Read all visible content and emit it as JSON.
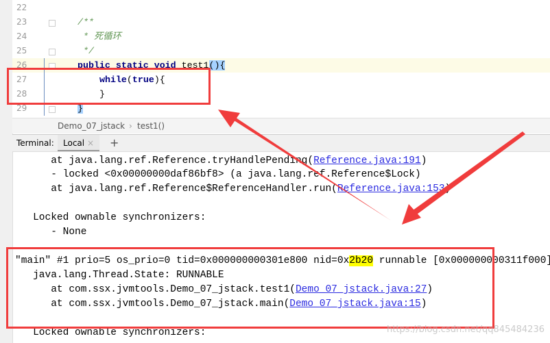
{
  "editor": {
    "lines": [
      {
        "num": "22",
        "text": ""
      },
      {
        "num": "23",
        "text": "/**"
      },
      {
        "num": "24",
        "text": " * 死循环"
      },
      {
        "num": "25",
        "text": " */"
      },
      {
        "num": "26",
        "kw": "public static void",
        "text": " test1",
        "sel": "(){"
      },
      {
        "num": "27",
        "kw": "while",
        "text": "(",
        "kw2": "true",
        "text2": "){"
      },
      {
        "num": "28",
        "text": "}"
      },
      {
        "num": "29",
        "text": "}"
      }
    ]
  },
  "breadcrumb": {
    "file": "Demo_07_jstack",
    "sep": "›",
    "method": "test1()"
  },
  "terminal": {
    "label": "Terminal:",
    "tab": "Local",
    "close": "×",
    "add": "+",
    "lines": {
      "l1a": "      at java.lang.ref.Reference.tryHandlePending(",
      "l1b": "Reference.java:191",
      "l1c": ")",
      "l2": "      - locked <0x00000000daf86bf8> (a java.lang.ref.Reference$Lock)",
      "l3a": "      at java.lang.ref.Reference$ReferenceHandler.run(",
      "l3b": "Reference.java:153",
      "l3c": ")",
      "l4": "   Locked ownable synchronizers:",
      "l5": "      - None",
      "l6a": "\"main\" #1 prio=5 os_prio=0 tid=0x000000000301e800 nid=0x",
      "l6b": "2b20",
      "l6c": " runnable [0x000000000311f000]",
      "l7": "   java.lang.Thread.State: RUNNABLE",
      "l8a": "      at com.ssx.jvmtools.Demo_07_jstack.test1(",
      "l8b": "Demo_07_jstack.java:27",
      "l8c": ")",
      "l9a": "      at com.ssx.jvmtools.Demo_07_jstack.main(",
      "l9b": "Demo_07_jstack.java:15",
      "l9c": ")",
      "l10": "   Locked ownable synchronizers:"
    }
  },
  "watermark": "https://blog.csdn.net/qq845484236",
  "colors": {
    "annotation": "#f03c3c",
    "highlight": "#ffff00",
    "link": "#2a2ae0"
  }
}
